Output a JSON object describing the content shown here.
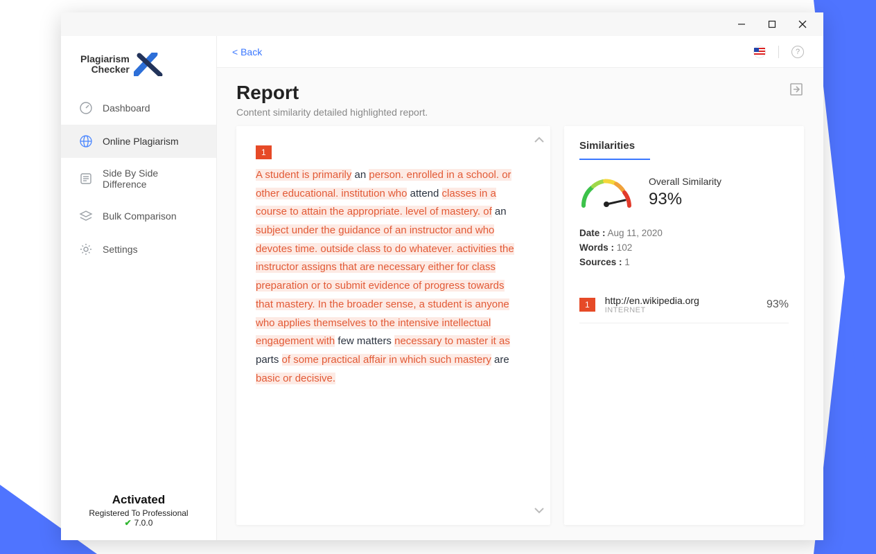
{
  "window": {
    "logo_line1": "Plagiarism",
    "logo_line2": "Checker"
  },
  "nav": {
    "dashboard": "Dashboard",
    "online": "Online Plagiarism",
    "sidebyside": "Side By Side Difference",
    "bulk": "Bulk Comparison",
    "settings": "Settings"
  },
  "footer": {
    "activated": "Activated",
    "registered": "Registered To Professional",
    "version": "7.0.0"
  },
  "topbar": {
    "back": "<  Back"
  },
  "header": {
    "title": "Report",
    "subtitle": "Content similarity detailed highlighted report."
  },
  "report": {
    "badge": "1",
    "segments": [
      {
        "t": "A student is primarily",
        "h": true
      },
      {
        "t": " an ",
        "h": false
      },
      {
        "t": "person. enrolled in a school. or other educational. institution who",
        "h": true
      },
      {
        "t": " attend ",
        "h": false
      },
      {
        "t": "classes in a course to attain the appropriate. level of mastery. of",
        "h": true
      },
      {
        "t": " an ",
        "h": false
      },
      {
        "t": "subject under the guidance of an instructor and who devotes time. outside class to do whatever. activities the instructor assigns that are necessary either for class preparation or to submit evidence of progress towards that mastery. In the broader sense, a student is anyone who applies themselves to the intensive intellectual engagement with",
        "h": true
      },
      {
        "t": " few matters ",
        "h": false
      },
      {
        "t": "necessary to master it as",
        "h": true
      },
      {
        "t": " parts ",
        "h": false
      },
      {
        "t": "of some practical affair in which such mastery",
        "h": true
      },
      {
        "t": " are ",
        "h": false
      },
      {
        "t": "basic or decisive.",
        "h": true
      }
    ]
  },
  "similarities": {
    "heading": "Similarities",
    "overall_label": "Overall Similarity",
    "overall_pct": "93%",
    "date_label": "Date :",
    "date_val": " Aug 11, 2020",
    "words_label": "Words :",
    "words_val": " 102",
    "sources_label": "Sources :",
    "sources_val": " 1",
    "sources": [
      {
        "id": "1",
        "url": "http://en.wikipedia.org",
        "type": "INTERNET",
        "pct": "93%"
      }
    ]
  }
}
